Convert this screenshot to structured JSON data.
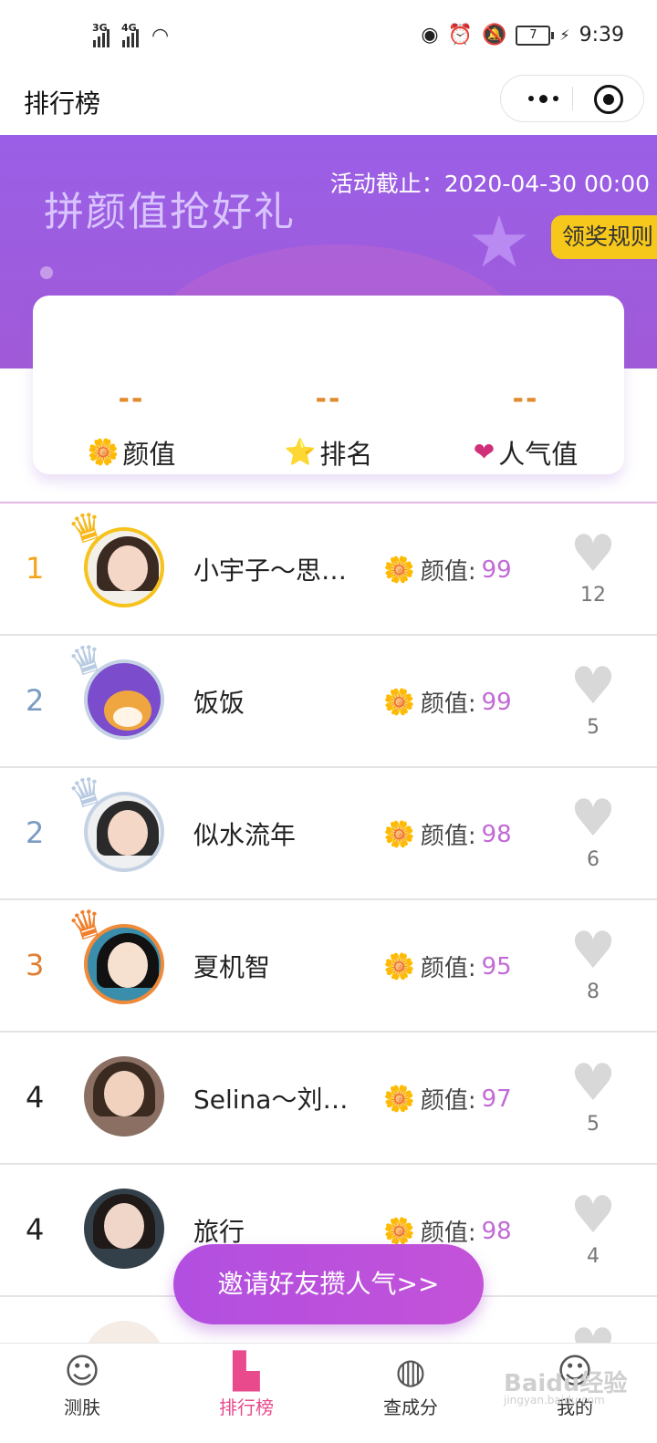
{
  "status_bar": {
    "sig1_label": "3G",
    "sig2_label": "4G",
    "battery": "7",
    "time": "9:39"
  },
  "nav": {
    "title": "排行榜"
  },
  "banner": {
    "title": "拼颜值抢好礼",
    "deadline": "活动截止：2020-04-30 00:00",
    "rules_button": "领奖规则"
  },
  "stats": [
    {
      "value": "--",
      "label": "颜值",
      "icon": "flower-icon"
    },
    {
      "value": "--",
      "label": "排名",
      "icon": "star-medal-icon"
    },
    {
      "value": "--",
      "label": "人气值",
      "icon": "heart-icon"
    }
  ],
  "score_label": "颜值:",
  "list": [
    {
      "rank": "1",
      "name": "小宇子～思…",
      "score": "99",
      "likes": "12",
      "rank_color": "#f4a51e",
      "crown": "gold"
    },
    {
      "rank": "2",
      "name": "饭饭",
      "score": "99",
      "likes": "5",
      "rank_color": "#7b9cc2",
      "crown": "silver"
    },
    {
      "rank": "2",
      "name": "似水流年",
      "score": "98",
      "likes": "6",
      "rank_color": "#7b9cc2",
      "crown": "silver"
    },
    {
      "rank": "3",
      "name": "夏机智",
      "score": "95",
      "likes": "8",
      "rank_color": "#e07f33",
      "crown": "bronze"
    },
    {
      "rank": "4",
      "name": "Selina～刘…",
      "score": "97",
      "likes": "5",
      "rank_color": "#222222",
      "crown": "none"
    },
    {
      "rank": "4",
      "name": "旅行",
      "score": "98",
      "likes": "4",
      "rank_color": "#222222",
      "crown": "none"
    }
  ],
  "invite_button": "邀请好友攒人气>>",
  "tabs": [
    {
      "label": "测肤",
      "icon": "face-scan-icon"
    },
    {
      "label": "排行榜",
      "icon": "podium-icon"
    },
    {
      "label": "查成分",
      "icon": "ingredient-icon"
    },
    {
      "label": "我的",
      "icon": "profile-icon"
    }
  ],
  "watermark": {
    "main": "Baidu经验",
    "sub": "jingyan.baidu.com"
  }
}
